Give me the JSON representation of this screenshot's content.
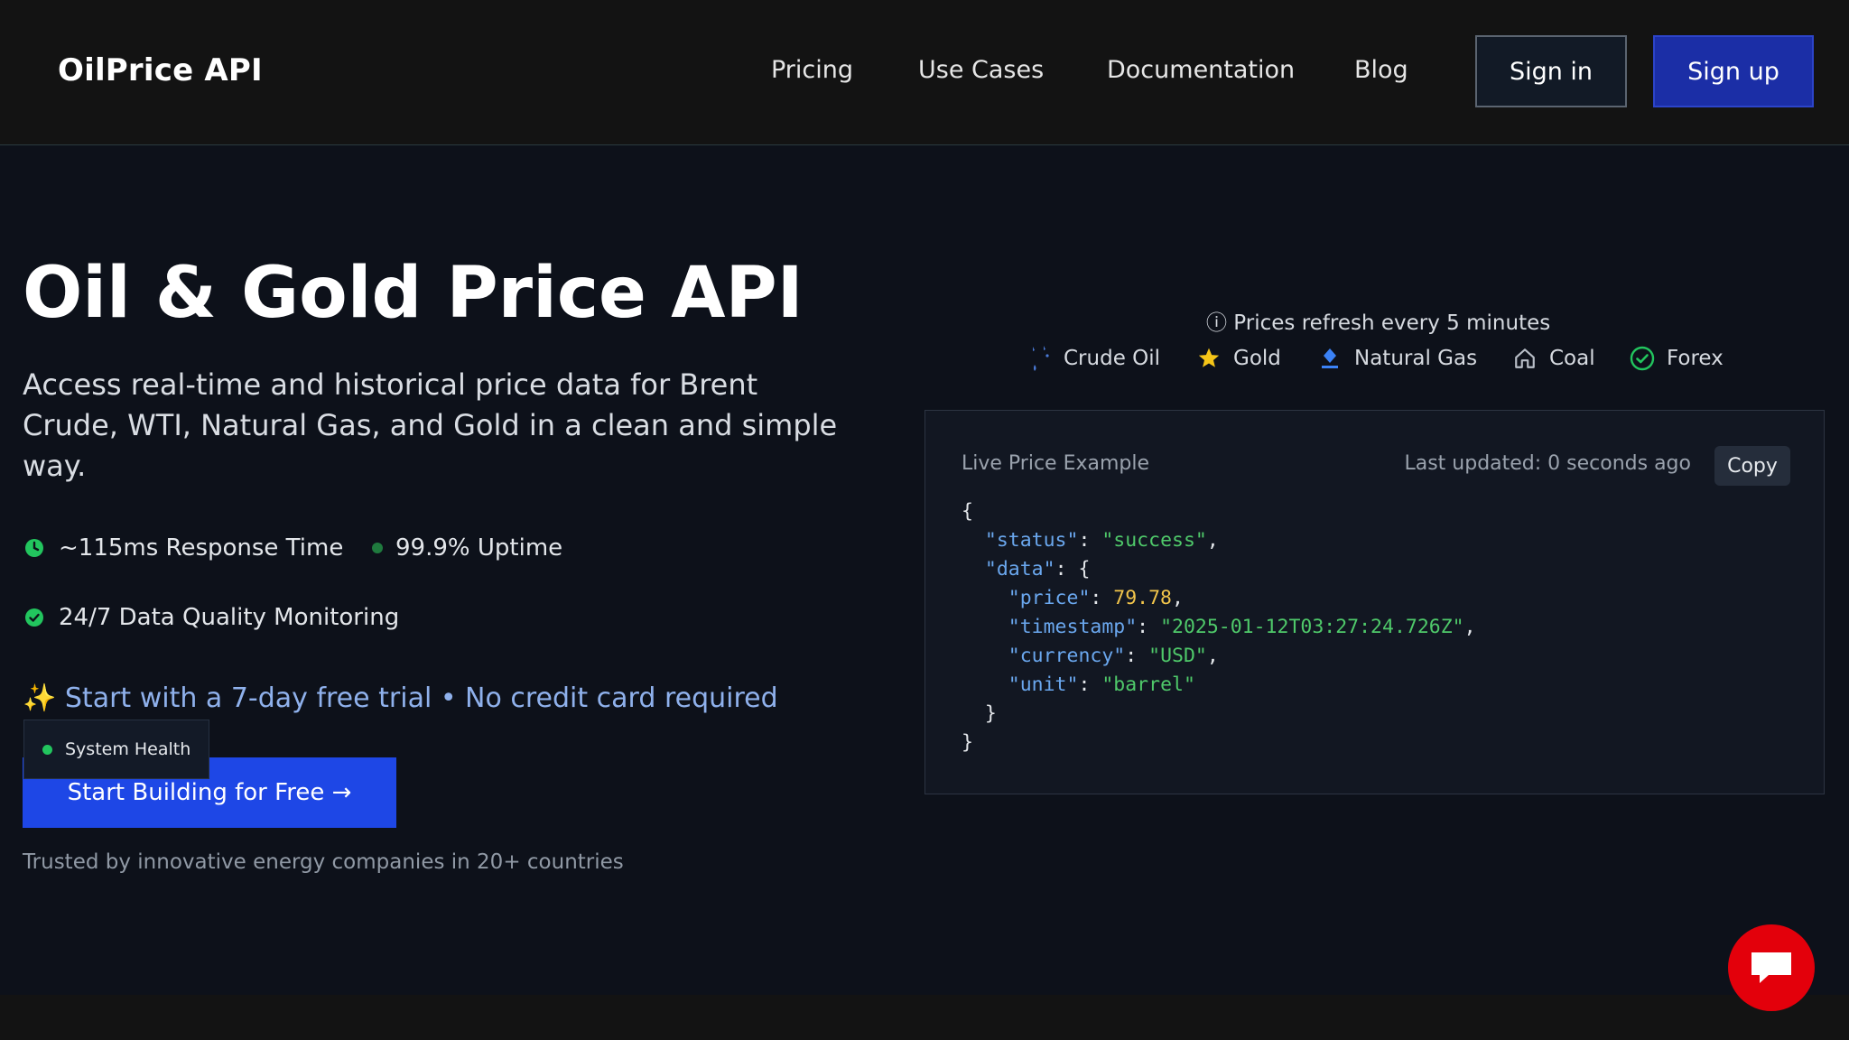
{
  "nav": {
    "logo": "OilPrice API",
    "links": [
      "Pricing",
      "Use Cases",
      "Documentation",
      "Blog"
    ],
    "sign_in": "Sign in",
    "sign_up": "Sign up"
  },
  "hero": {
    "title": "Oil & Gold Price API",
    "subtitle": "Access real-time and historical price data for Brent Crude, WTI, Natural Gas, and Gold in a clean and simple way.",
    "stats": {
      "response_time": "~115ms Response Time",
      "uptime": "99.9% Uptime",
      "monitoring": "24/7 Data Quality Monitoring"
    },
    "trial": "✨ Start with a 7-day free trial • No credit card required",
    "cta": "Start Building for Free →",
    "system_health": "System Health",
    "trusted": "Trusted by innovative energy companies in 20+ countries"
  },
  "prices": {
    "refresh_note": "ⓘ Prices refresh every 5 minutes",
    "commodities": [
      {
        "label": "Crude Oil",
        "icon": "oil-drops-icon"
      },
      {
        "label": "Gold",
        "icon": "star-icon"
      },
      {
        "label": "Natural Gas",
        "icon": "gas-flame-icon"
      },
      {
        "label": "Coal",
        "icon": "house-icon"
      },
      {
        "label": "Forex",
        "icon": "check-circle-icon"
      }
    ]
  },
  "example": {
    "title": "Live Price Example",
    "updated": "Last updated: 0 seconds ago",
    "copy": "Copy",
    "status_key": "\"status\"",
    "status_val": "\"success\"",
    "data_key": "\"data\"",
    "price_key": "\"price\"",
    "price_val": "79.78",
    "timestamp_key": "\"timestamp\"",
    "timestamp_val": "\"2025-01-12T03:27:24.726Z\"",
    "currency_key": "\"currency\"",
    "currency_val": "\"USD\"",
    "unit_key": "\"unit\"",
    "unit_val": "\"barrel\""
  },
  "colors": {
    "cta": "#1e47e6",
    "sign_up": "#1b2ea6",
    "chat": "#e3000b",
    "status_green": "#22c55e"
  }
}
